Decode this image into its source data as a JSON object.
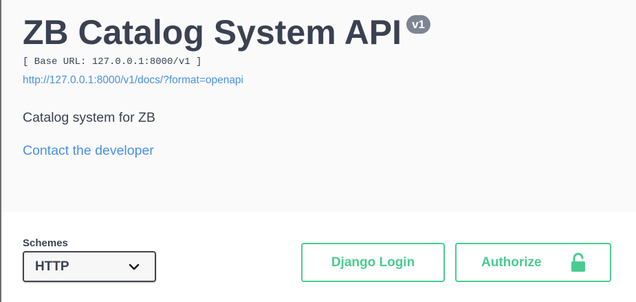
{
  "info": {
    "title": "ZB Catalog System API",
    "version": "v1",
    "base_url": "[ Base URL: 127.0.0.1:8000/v1 ]",
    "docs_link": "http://127.0.0.1:8000/v1/docs/?format=openapi",
    "description": "Catalog system for ZB",
    "contact_link": "Contact the developer"
  },
  "schemes": {
    "label": "Schemes",
    "selected": "HTTP"
  },
  "buttons": {
    "django_login": "Django Login",
    "authorize": "Authorize"
  },
  "icons": {
    "select": "chevron-down-icon",
    "authorize": "lock-icon"
  },
  "colors": {
    "text": "#3b4151",
    "link": "#4990e2",
    "accent_green": "#49cc90",
    "version_badge": "#7d8492",
    "info_background": "#fafafa"
  }
}
